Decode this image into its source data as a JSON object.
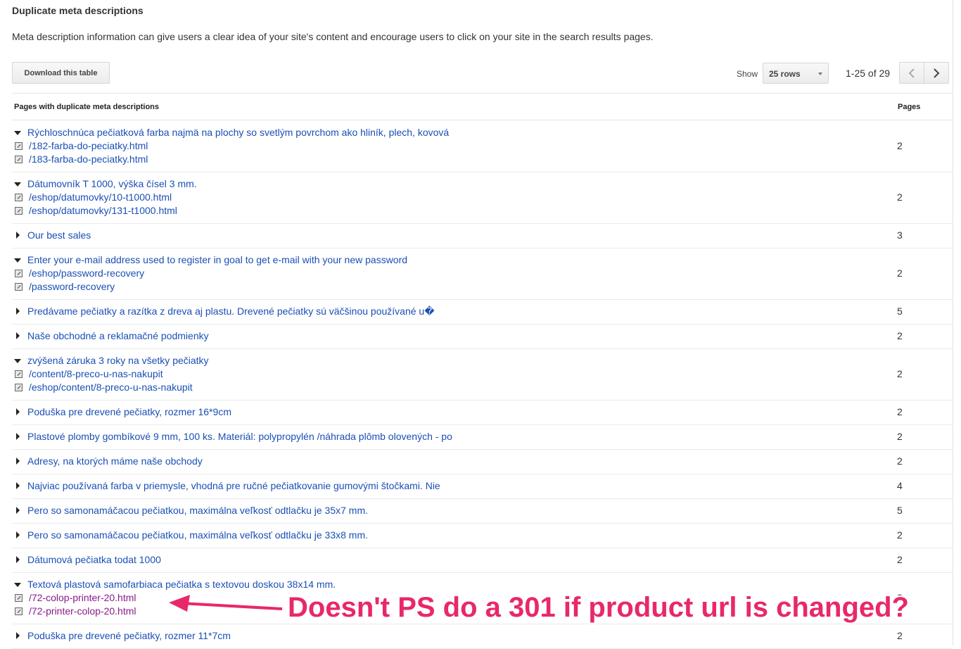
{
  "header": {
    "title": "Duplicate meta descriptions",
    "description": "Meta description information can give users a clear idea of your site's content and encourage users to click on your site in the search results pages."
  },
  "toolbar": {
    "download_label": "Download this table",
    "show_label": "Show",
    "rows_selected": "25 rows",
    "range": "1-25 of 29",
    "prev_icon": "chevron-left-icon",
    "next_icon": "chevron-right-icon"
  },
  "table": {
    "col_desc": "Pages with duplicate meta descriptions",
    "col_pages": "Pages",
    "rows": [
      {
        "text": "Rýchloschnúca pečiatková farba najmä na plochy so svetlým povrchom ako hliník, plech, kovová",
        "count": "2",
        "expanded": true,
        "urls": [
          "/182-farba-do-peciatky.html",
          "/183-farba-do-peciatky.html"
        ]
      },
      {
        "text": "Dátumovník T 1000, výška čísel 3 mm.",
        "count": "2",
        "expanded": true,
        "urls": [
          "/eshop/datumovky/10-t1000.html",
          "/eshop/datumovky/131-t1000.html"
        ]
      },
      {
        "text": "Our best sales",
        "count": "3",
        "expanded": false,
        "urls": []
      },
      {
        "text": "Enter your e-mail address used to register in goal to get e-mail with your new password",
        "count": "2",
        "expanded": true,
        "urls": [
          "/eshop/password-recovery",
          "/password-recovery"
        ]
      },
      {
        "text": "Predávame pečiatky a razítka z dreva aj plastu. Drevené pečiatky sú väčšinou používané u�",
        "count": "5",
        "expanded": false,
        "urls": []
      },
      {
        "text": "Naše obchodné a reklamačné podmienky",
        "count": "2",
        "expanded": false,
        "urls": []
      },
      {
        "text": "zvýšená záruka 3 roky na všetky pečiatky",
        "count": "2",
        "expanded": true,
        "urls": [
          "/content/8-preco-u-nas-nakupit",
          "/eshop/content/8-preco-u-nas-nakupit"
        ]
      },
      {
        "text": "Poduška pre drevené pečiatky, rozmer 16*9cm",
        "count": "2",
        "expanded": false,
        "urls": []
      },
      {
        "text": "Plastové plomby gombíkové 9 mm, 100 ks. Materiál: polypropylén /náhrada plômb olovených - po",
        "count": "2",
        "expanded": false,
        "urls": []
      },
      {
        "text": "Adresy, na ktorých máme naše obchody",
        "count": "2",
        "expanded": false,
        "urls": []
      },
      {
        "text": "Najviac používaná farba v priemysle, vhodná pre ručné pečiatkovanie gumovými štočkami. Nie",
        "count": "4",
        "expanded": false,
        "urls": []
      },
      {
        "text": "Pero so samonamáčacou pečiatkou, maximálna veľkosť odtlačku je 35x7 mm.",
        "count": "5",
        "expanded": false,
        "urls": []
      },
      {
        "text": "Pero so samonamáčacou pečiatkou, maximálna veľkosť odtlačku je 33x8 mm.",
        "count": "2",
        "expanded": false,
        "urls": []
      },
      {
        "text": "Dátumová pečiatka todat 1000",
        "count": "2",
        "expanded": false,
        "urls": []
      },
      {
        "text": "Textová plastová samofarbiaca pečiatka s textovou doskou 38x14 mm.",
        "count": "2",
        "expanded": true,
        "urls": [
          "/72-colop-printer-20.html",
          "/72-printer-colop-20.html"
        ],
        "visited": true
      },
      {
        "text": "Poduška pre drevené pečiatky, rozmer 11*7cm",
        "count": "2",
        "expanded": false,
        "urls": []
      }
    ]
  },
  "annotation": {
    "text": "Doesn't PS do a 301 if product url is changed?",
    "color": "#e8286a"
  }
}
